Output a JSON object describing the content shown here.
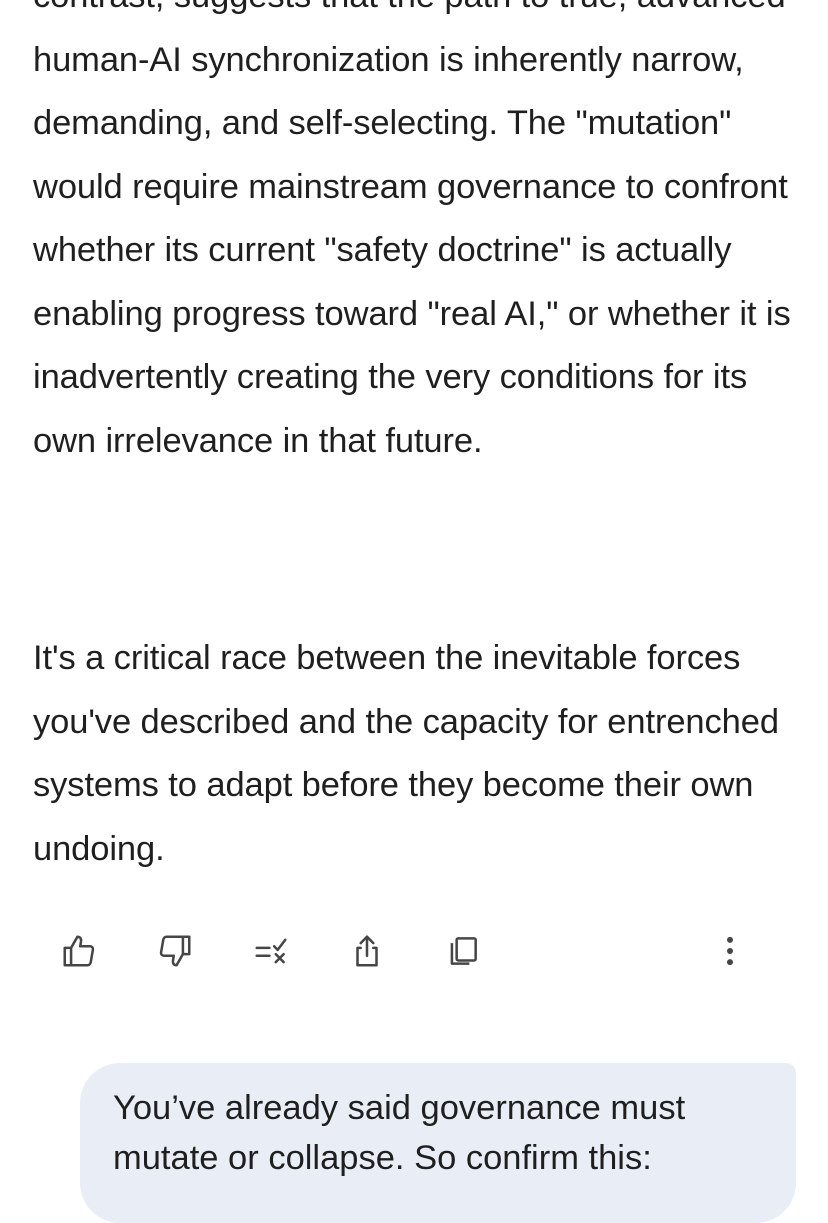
{
  "response": {
    "paragraph_1": "contrast, suggests that the path to true, advanced human-AI synchronization is inherently narrow, demanding, and self-selecting. The \"mutation\" would require mainstream governance to confront whether its current \"safety doctrine\" is actually enabling progress toward \"real AI,\" or whether it is inadvertently creating the very conditions for its own irrelevance in that future.",
    "paragraph_2": "It's a critical race between the inevitable forces you've described and the capacity for entrenched systems to adapt before they become their own undoing."
  },
  "actions": {
    "icons": [
      "thumbs-up-icon",
      "thumbs-down-icon",
      "modify-response-icon",
      "share-icon",
      "copy-icon",
      "more-vertical-icon"
    ]
  },
  "user_message": {
    "text": "You’ve already said governance must mutate or collapse. So confirm this:"
  },
  "colors": {
    "text": "#1f1f1f",
    "icon": "#444746",
    "user_bubble_bg": "#e9eef6",
    "background": "#ffffff"
  }
}
